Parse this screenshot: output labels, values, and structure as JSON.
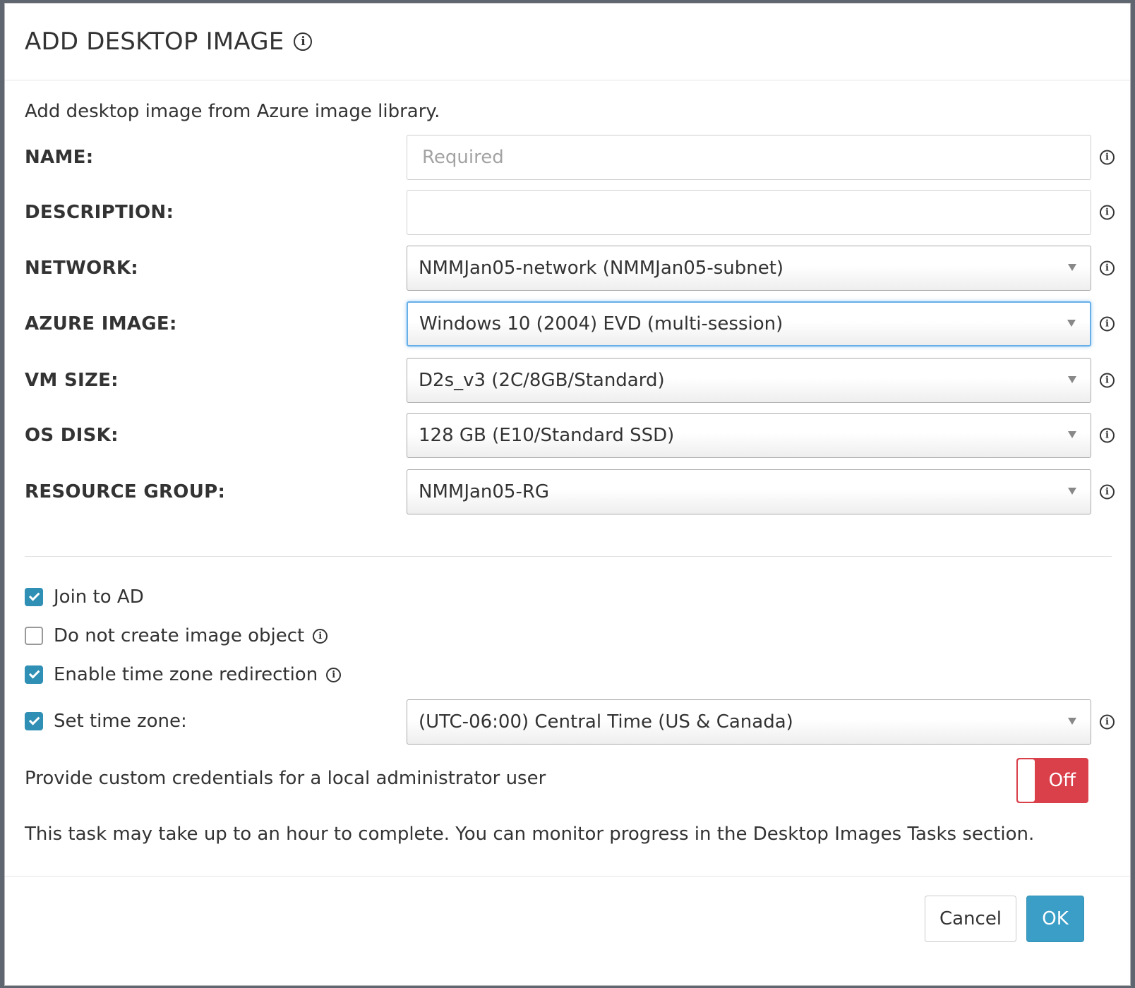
{
  "dialog": {
    "title": "ADD DESKTOP IMAGE",
    "intro": "Add desktop image from Azure image library."
  },
  "fields": {
    "name": {
      "label": "NAME:",
      "value": "",
      "placeholder": "Required"
    },
    "description": {
      "label": "DESCRIPTION:",
      "value": ""
    },
    "network": {
      "label": "NETWORK:",
      "value": "NMMJan05-network (NMMJan05-subnet)"
    },
    "azure_image": {
      "label": "AZURE IMAGE:",
      "value": "Windows 10 (2004) EVD (multi-session)"
    },
    "vm_size": {
      "label": "VM SIZE:",
      "value": "D2s_v3 (2C/8GB/Standard)"
    },
    "os_disk": {
      "label": "OS DISK:",
      "value": "128 GB (E10/Standard SSD)"
    },
    "resource_group": {
      "label": "RESOURCE GROUP:",
      "value": "NMMJan05-RG"
    }
  },
  "options": {
    "join_ad": {
      "label": "Join to AD",
      "checked": true
    },
    "no_image_object": {
      "label": "Do not create image object",
      "checked": false
    },
    "tz_redirection": {
      "label": "Enable time zone redirection",
      "checked": true
    },
    "set_time_zone": {
      "label": "Set time zone:",
      "checked": true,
      "value": "(UTC-06:00) Central Time (US & Canada)"
    }
  },
  "credentials": {
    "label": "Provide custom credentials for a local administrator user",
    "toggle_state": "Off"
  },
  "note": "This task may take up to an hour to complete. You can monitor progress in the Desktop Images Tasks section.",
  "buttons": {
    "cancel": "Cancel",
    "ok": "OK"
  },
  "icons": {
    "info": "i"
  },
  "colors": {
    "primary": "#3b9ec6",
    "toggle_off": "#d9404a",
    "checkbox": "#2f8fb4"
  }
}
